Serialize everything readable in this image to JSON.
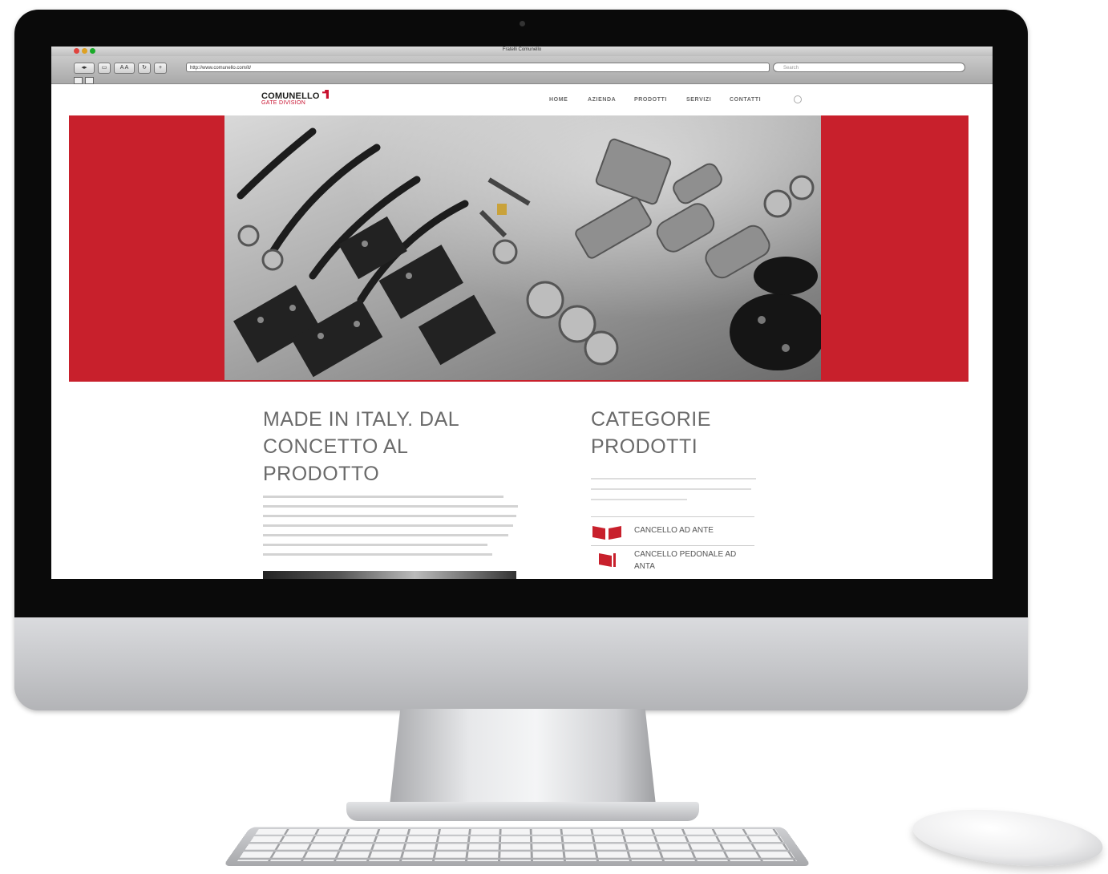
{
  "browser": {
    "window_title": "Fratelli Comunello",
    "url": "http://www.comunello.com/it/",
    "search_placeholder": "Search"
  },
  "site": {
    "logo_main": "COMUNELLO",
    "logo_sub": "GATE DIVISION",
    "nav": [
      "HOME",
      "AZIENDA",
      "PRODOTTI",
      "SERVIZI",
      "CONTATTI"
    ],
    "heading_left": "MADE IN ITALY. DAL CONCETTO AL PRODOTTO",
    "heading_right": "CATEGORIE PRODOTTI",
    "categories": [
      {
        "label": "CANCELLO AD ANTE",
        "icon": "double-gate-icon"
      },
      {
        "label": "CANCELLO PEDONALE AD ANTA",
        "icon": "single-gate-icon"
      }
    ]
  },
  "colors": {
    "brand_red": "#c8202c",
    "text_gray": "#6a6a6a"
  }
}
